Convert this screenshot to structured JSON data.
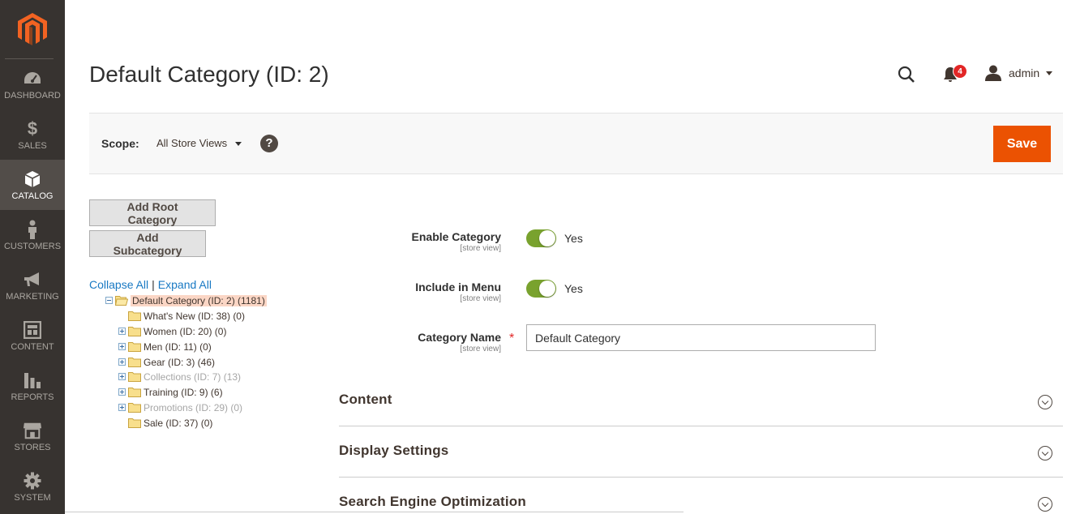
{
  "sidebar": {
    "items": [
      {
        "label": "DASHBOARD",
        "icon": "dashboard-icon"
      },
      {
        "label": "SALES",
        "icon": "dollar-icon"
      },
      {
        "label": "CATALOG",
        "icon": "box-icon",
        "active": true
      },
      {
        "label": "CUSTOMERS",
        "icon": "person-icon"
      },
      {
        "label": "MARKETING",
        "icon": "megaphone-icon"
      },
      {
        "label": "CONTENT",
        "icon": "layout-icon"
      },
      {
        "label": "REPORTS",
        "icon": "bar-chart-icon"
      },
      {
        "label": "STORES",
        "icon": "storefront-icon"
      },
      {
        "label": "SYSTEM",
        "icon": "gear-icon"
      }
    ]
  },
  "header": {
    "title": "Default Category (ID: 2)",
    "notification_count": "4",
    "user": "admin"
  },
  "scope": {
    "label": "Scope:",
    "value": "All Store Views",
    "help": "?",
    "save_label": "Save"
  },
  "actions": {
    "add_root": "Add Root Category",
    "add_sub": "Add Subcategory"
  },
  "tree": {
    "collapse_all": "Collapse All",
    "separator": "|",
    "expand_all": "Expand All",
    "nodes": [
      {
        "label": "Default Category (ID: 2) (1181)"
      },
      {
        "label": "What's New (ID: 38) (0)"
      },
      {
        "label": "Women (ID: 20) (0)"
      },
      {
        "label": "Men (ID: 11) (0)"
      },
      {
        "label": "Gear (ID: 3) (46)"
      },
      {
        "label": "Collections (ID: 7) (13)"
      },
      {
        "label": "Training (ID: 9) (6)"
      },
      {
        "label": "Promotions (ID: 29) (0)"
      },
      {
        "label": "Sale (ID: 37) (0)"
      }
    ]
  },
  "form": {
    "enable_category": {
      "label": "Enable Category",
      "scope": "[store view]",
      "value": "Yes"
    },
    "include_in_menu": {
      "label": "Include in Menu",
      "scope": "[store view]",
      "value": "Yes"
    },
    "category_name": {
      "label": "Category Name",
      "scope": "[store view]",
      "value": "Default Category",
      "required": "*"
    }
  },
  "sections": [
    {
      "title": "Content"
    },
    {
      "title": "Display Settings"
    },
    {
      "title": "Search Engine Optimization"
    }
  ],
  "colors": {
    "accent": "#eb5202",
    "sidebar": "#373330",
    "toggle_on": "#79a22e",
    "link": "#1979c3"
  }
}
